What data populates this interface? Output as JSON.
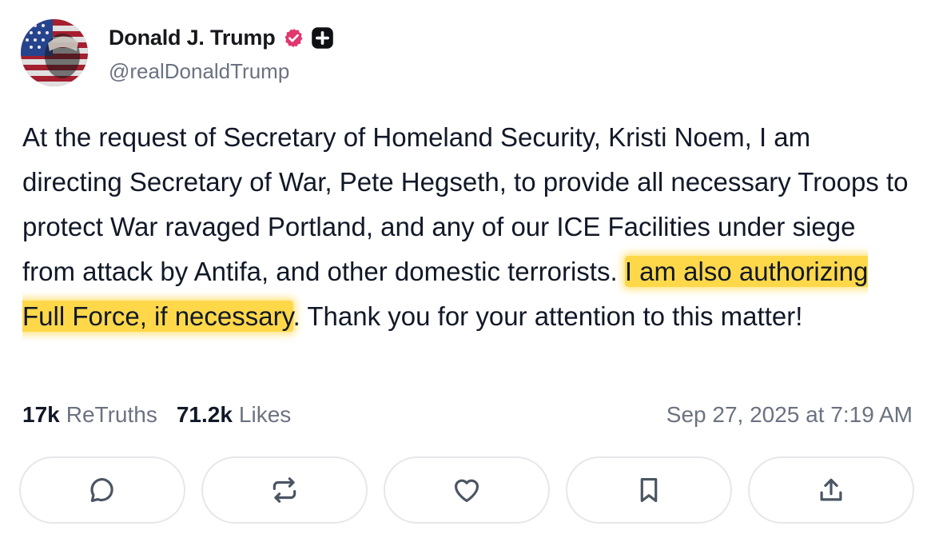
{
  "author": {
    "display_name": "Donald J. Trump",
    "handle": "@realDonaldTrump",
    "verified_badge_color": "#e2366f",
    "avatar_icon": "avatar-flag-portrait"
  },
  "post": {
    "text_before": "At the request of Secretary of Homeland Security, Kristi Noem, I am directing Secretary of War, Pete Hegseth, to provide all necessary Troops to protect War ravaged Portland, and any of our ICE Facilities under siege from attack by Antifa, and other domestic terrorists. ",
    "text_highlighted": "I am also authorizing Full Force, if necessary",
    "text_after": ". Thank you for your attention to this matter!",
    "highlight_color": "#ffd84a"
  },
  "stats": {
    "retruths_count": "17k",
    "retruths_label": "ReTruths",
    "likes_count": "71.2k",
    "likes_label": "Likes",
    "timestamp": "Sep 27, 2025 at 7:19 AM"
  },
  "actions": [
    {
      "icon": "reply-icon"
    },
    {
      "icon": "retruth-icon"
    },
    {
      "icon": "like-icon"
    },
    {
      "icon": "bookmark-icon"
    },
    {
      "icon": "share-icon"
    }
  ]
}
